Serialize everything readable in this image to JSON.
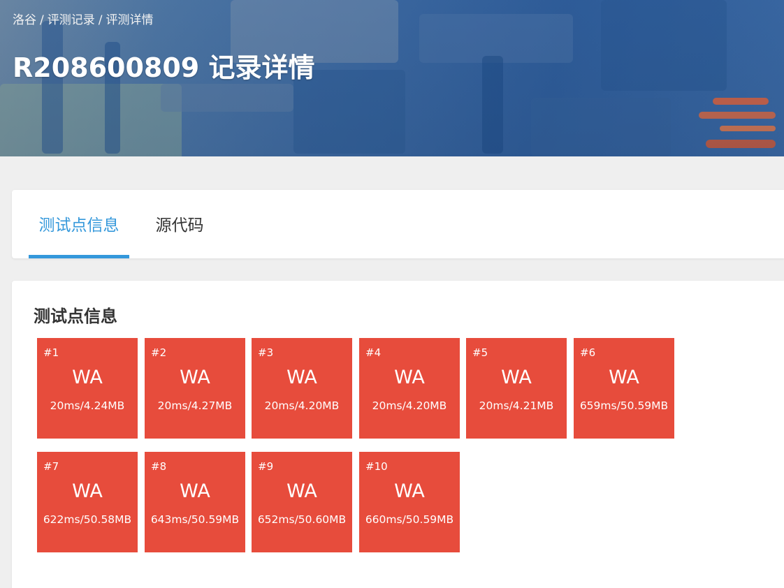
{
  "header": {
    "breadcrumb": [
      "洛谷",
      "评测记录",
      "评测详情"
    ],
    "breadcrumb_separator": "/",
    "title": "R208600809 记录详情"
  },
  "tabs": [
    {
      "label": "测试点信息",
      "active": true
    },
    {
      "label": "源代码",
      "active": false
    }
  ],
  "section": {
    "title": "测试点信息"
  },
  "colors": {
    "accent": "#3498db",
    "wa": "#e74c3c"
  },
  "testcases": [
    {
      "id": "#1",
      "status": "WA",
      "stat": "20ms/4.24MB"
    },
    {
      "id": "#2",
      "status": "WA",
      "stat": "20ms/4.27MB"
    },
    {
      "id": "#3",
      "status": "WA",
      "stat": "20ms/4.20MB"
    },
    {
      "id": "#4",
      "status": "WA",
      "stat": "20ms/4.20MB"
    },
    {
      "id": "#5",
      "status": "WA",
      "stat": "20ms/4.21MB"
    },
    {
      "id": "#6",
      "status": "WA",
      "stat": "659ms/50.59MB"
    },
    {
      "id": "#7",
      "status": "WA",
      "stat": "622ms/50.58MB"
    },
    {
      "id": "#8",
      "status": "WA",
      "stat": "643ms/50.59MB"
    },
    {
      "id": "#9",
      "status": "WA",
      "stat": "652ms/50.60MB"
    },
    {
      "id": "#10",
      "status": "WA",
      "stat": "660ms/50.59MB"
    }
  ]
}
